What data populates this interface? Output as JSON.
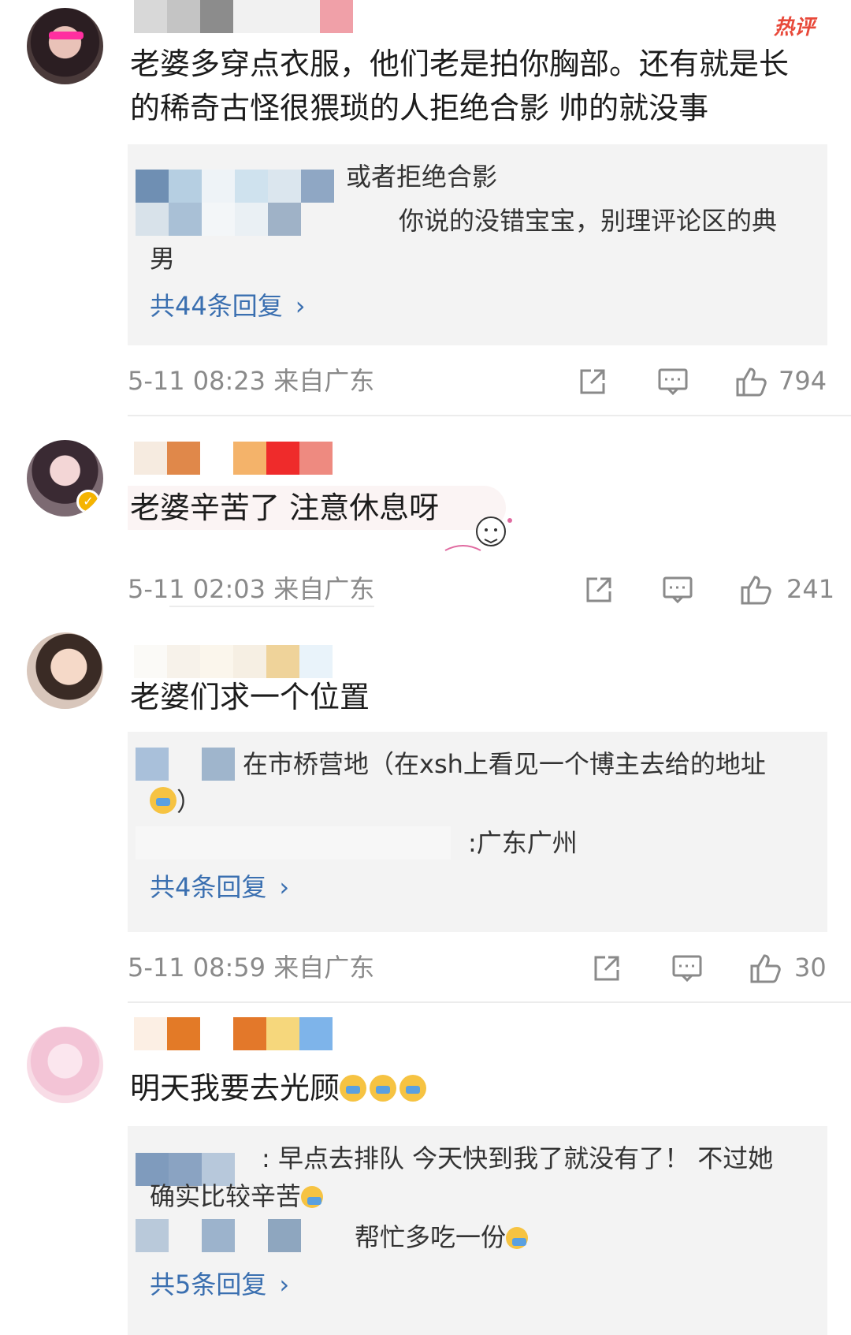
{
  "comments": [
    {
      "hot_label": "热评",
      "text_line1": "老婆多穿点衣服，他们老是拍你胸部。还有就是长",
      "text_line2": "的稀奇古怪很猥琐的人拒绝合影 帅的就没事",
      "reply1": "或者拒绝合影",
      "reply2_line1": "你说的没错宝宝，别理评论区的典",
      "reply2_line2": "男",
      "more_replies": "共44条回复",
      "time": "5-11 08:23 来自广东",
      "likes": "794"
    },
    {
      "text": "老婆辛苦了 注意休息呀",
      "time": "5-11 02:03 来自广东",
      "likes": "241"
    },
    {
      "text": "老婆们求一个位置",
      "reply1_line1": "在市桥营地（在xsh上看见一个博主去给的地址",
      "reply1_line2": "）",
      "reply2": ":广东广州",
      "more_replies": "共4条回复",
      "time": "5-11 08:59 来自广东",
      "likes": "30"
    },
    {
      "text": "明天我要去光顾",
      "reply1_line1": ": 早点去排队 今天快到我了就没有了！ 不过她",
      "reply1_line2": "确实比较辛苦",
      "reply2": "帮忙多吃一份",
      "more_replies": "共5条回复"
    }
  ],
  "colors": {
    "link_blue": "#3a6fb0",
    "meta_gray": "#8a8a8a",
    "hot_red": "#e8493a",
    "reply_bg": "#f3f3f3"
  },
  "icons": [
    "share-icon",
    "comment-icon",
    "like-icon",
    "chevron-right-icon",
    "verified-badge-icon"
  ]
}
